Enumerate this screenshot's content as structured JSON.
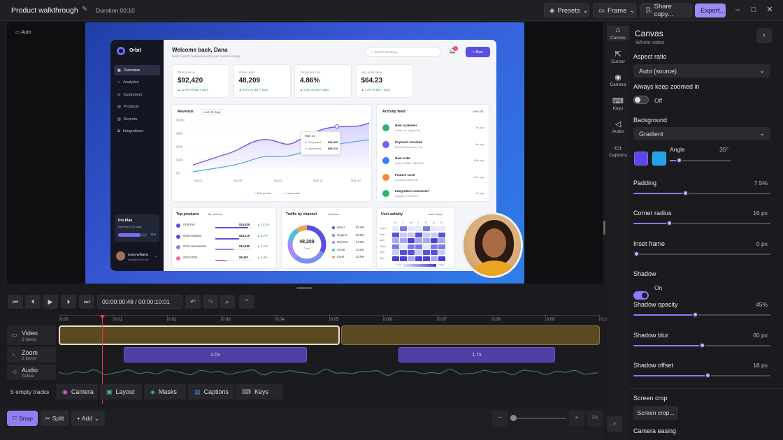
{
  "titlebar": {
    "title": "Product walkthrough",
    "duration": "Duration 00:10",
    "presets": "Presets",
    "frame": "Frame",
    "share": "Share copy...",
    "export": "Export..."
  },
  "stage": {
    "auto_label": "Auto"
  },
  "app": {
    "brand": "Orbit",
    "nav": [
      "Overview",
      "Analytics",
      "Customers",
      "Products",
      "Reports",
      "Integrations"
    ],
    "plan": {
      "title": "Pro Plan",
      "sub": "Renews in 12 days",
      "pct": "75%",
      "fill": 0.75
    },
    "user": {
      "name": "Dana Williams",
      "email": "dana@orbit.com"
    },
    "welcome": "Welcome back, Dana",
    "welcome_sub": "Here's what's happening with your business today.",
    "search_placeholder": "Search anything...",
    "notif_count": "3",
    "new_btn": "+ New",
    "kpis": [
      {
        "label": "Total revenue",
        "value": "$92,420",
        "delta": "▲ 12.4% vs last 7 days"
      },
      {
        "label": "Active users",
        "value": "48,209",
        "delta": "▲ 8.6% vs last 7 days"
      },
      {
        "label": "Conversion rate",
        "value": "4.86%",
        "delta": "▲ 6.3% vs last 7 days"
      },
      {
        "label": "Avg. order value",
        "value": "$64.23",
        "delta": "▲ 7.2% vs last 7 days"
      }
    ],
    "revenue": {
      "title": "Revenue",
      "range": "Last 30 days",
      "yticks": [
        "$100K",
        "$80K",
        "$60K",
        "$30K",
        "$0"
      ],
      "xticks": [
        "Apr 21",
        "Apr 28",
        "May 5",
        "May 12",
        "May 19"
      ],
      "legend_this": "This period",
      "legend_last": "Last period",
      "tooltip": {
        "date": "May 14",
        "this_label": "This period",
        "this_val": "$96,430",
        "last_label": "Last period",
        "last_val": "$86,210"
      }
    },
    "activity": {
      "title": "Activity feed",
      "view_all": "View all",
      "items": [
        {
          "title": "New customer",
          "sub": "Acme Inc. signed up",
          "time": "2m ago",
          "color": "#2fb36b"
        },
        {
          "title": "Payment received",
          "sub": "$1,240 from Acme Inc.",
          "time": "6m ago",
          "color": "#7a5cf0"
        },
        {
          "title": "New order",
          "sub": "Order #1256 · $320.00",
          "time": "15m ago",
          "color": "#3a7df0"
        },
        {
          "title": "Feature used",
          "sub": "Advanced Reports",
          "time": "32m ago",
          "color": "#f08a3a"
        },
        {
          "title": "Integration connected",
          "sub": "Shopify connected",
          "time": "1h ago",
          "color": "#2fb36b"
        }
      ]
    },
    "top_products": {
      "title": "Top products",
      "sort": "By revenue",
      "rows": [
        {
          "name": "Orbit Pro",
          "value": "$34,409",
          "delta": "▲ 14.2%",
          "fill": 0.9,
          "color": "#5b4fe0"
        },
        {
          "name": "Orbit Analytics",
          "value": "$18,219",
          "delta": "▲ 8.7%",
          "fill": 0.65,
          "color": "#5b4fe0"
        },
        {
          "name": "Orbit Automations",
          "value": "$12,880",
          "delta": "▲ 7.1%",
          "fill": 0.5,
          "color": "#7a8ff0"
        },
        {
          "name": "Orbit CRM",
          "value": "$8,430",
          "delta": "▲ 5.4%",
          "fill": 0.3,
          "color": "#f07080"
        }
      ]
    },
    "traffic": {
      "title": "Traffic by channel",
      "sort": "Sessions",
      "total": "48,209",
      "total_label": "Total",
      "rows": [
        {
          "name": "Direct",
          "pct": "32.4%",
          "color": "#5b4fe0"
        },
        {
          "name": "Organic",
          "pct": "28.6%",
          "color": "#7a8ff0"
        },
        {
          "name": "Referral",
          "pct": "17.2%",
          "color": "#a58cf5"
        },
        {
          "name": "Social",
          "pct": "12.2%",
          "color": "#4ac0e0"
        },
        {
          "name": "Email",
          "pct": "10.0%",
          "color": "#f0a050"
        }
      ]
    },
    "user_activity": {
      "title": "User activity",
      "range": "Last 7 days",
      "days": [
        "M",
        "T",
        "W",
        "T",
        "F",
        "S",
        "S"
      ],
      "hours": [
        "12am",
        "4am",
        "8am",
        "12pm",
        "4pm",
        "8pm"
      ],
      "low": "Low",
      "high": "High"
    }
  },
  "player": {
    "time": "00:00:00:48 / 00:00:10:01"
  },
  "timeline": {
    "ticks": [
      "0:00",
      "0:01",
      "0:02",
      "0:03",
      "0:04",
      "0:05",
      "0:06",
      "0:07",
      "0:08",
      "0:09",
      "0:10"
    ],
    "tracks": [
      {
        "name": "Video",
        "sub": "2 items"
      },
      {
        "name": "Zoom",
        "sub": "2 items"
      },
      {
        "name": "Audio",
        "sub": "Active"
      }
    ],
    "zoom_clips": [
      "2.0x",
      "1.7x"
    ],
    "empty_tracks": "5 empty tracks",
    "chips": [
      "Camera",
      "Layout",
      "Masks",
      "Captions",
      "Keys"
    ]
  },
  "bottom": {
    "snap": "Snap",
    "split": "Split",
    "add": "+ Add",
    "fit": "Fit"
  },
  "rail": [
    {
      "label": "Canvas",
      "icon": "home-icon"
    },
    {
      "label": "Cursor",
      "icon": "cursor-icon"
    },
    {
      "label": "Camera",
      "icon": "camera-icon"
    },
    {
      "label": "Keys",
      "icon": "keyboard-icon"
    },
    {
      "label": "Audio",
      "icon": "speaker-icon"
    },
    {
      "label": "Captions",
      "icon": "captions-icon"
    }
  ],
  "panel": {
    "title": "Canvas",
    "subtitle": "Whole video",
    "aspect_label": "Aspect ratio",
    "aspect_value": "Auto (source)",
    "zoom_label": "Always keep zoomed in",
    "zoom_value": "Off",
    "bg_label": "Background",
    "bg_value": "Gradient",
    "angle_label": "Angle",
    "angle_value": "35°",
    "padding": {
      "label": "Padding",
      "value": "7.5%",
      "level": 0.38
    },
    "radius": {
      "label": "Corner radius",
      "value": "16 px",
      "level": 0.26
    },
    "inset": {
      "label": "Inset frame",
      "value": "0 px",
      "level": 0.02
    },
    "shadow_label": "Shadow",
    "shadow_value": "On",
    "opacity": {
      "label": "Shadow opacity",
      "value": "45%",
      "level": 0.45
    },
    "blur": {
      "label": "Shadow blur",
      "value": "60 px",
      "level": 0.5
    },
    "offset": {
      "label": "Shadow offset",
      "value": "18 px",
      "level": 0.54
    },
    "crop_label": "Screen crop",
    "crop_btn": "Screen crop...",
    "easing_label": "Camera easing"
  }
}
